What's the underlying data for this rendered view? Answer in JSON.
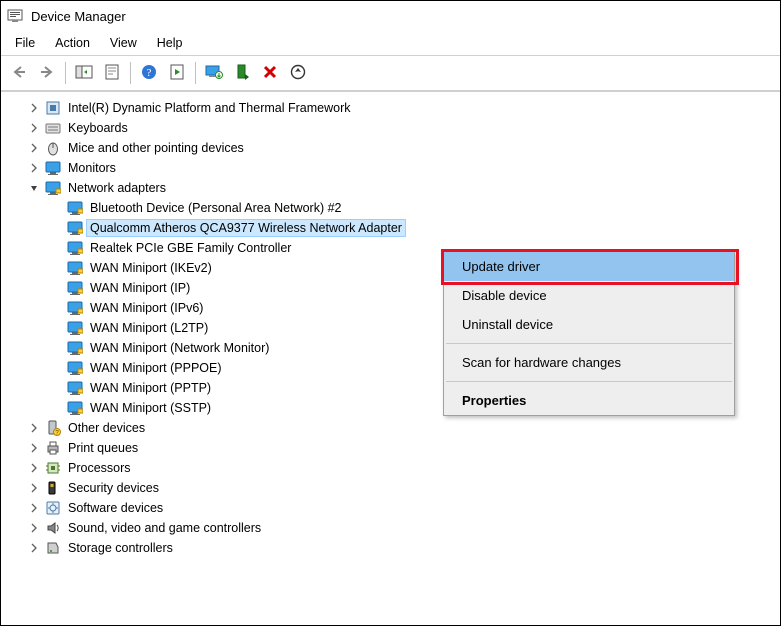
{
  "window": {
    "title": "Device Manager"
  },
  "menubar": {
    "items": [
      "File",
      "Action",
      "View",
      "Help"
    ]
  },
  "toolbar": {
    "back": "back",
    "forward": "forward",
    "showhide": "showhide",
    "properties": "properties",
    "help": "help",
    "refresh": "refresh",
    "updatecfg": "updatecfg",
    "enable": "enable",
    "uninstall": "uninstall",
    "scan": "scan"
  },
  "tree": [
    {
      "icon": "platform",
      "label": "Intel(R) Dynamic Platform and Thermal Framework",
      "expand": ">"
    },
    {
      "icon": "keyboard",
      "label": "Keyboards",
      "expand": ">"
    },
    {
      "icon": "mouse",
      "label": "Mice and other pointing devices",
      "expand": ">"
    },
    {
      "icon": "monitor",
      "label": "Monitors",
      "expand": ">"
    },
    {
      "icon": "network",
      "label": "Network adapters",
      "expand": "v",
      "children": [
        {
          "icon": "network",
          "label": "Bluetooth Device (Personal Area Network) #2"
        },
        {
          "icon": "network",
          "label": "Qualcomm Atheros QCA9377 Wireless Network Adapter",
          "selected": true
        },
        {
          "icon": "network",
          "label": "Realtek PCIe GBE Family Controller"
        },
        {
          "icon": "network",
          "label": "WAN Miniport (IKEv2)"
        },
        {
          "icon": "network",
          "label": "WAN Miniport (IP)"
        },
        {
          "icon": "network",
          "label": "WAN Miniport (IPv6)"
        },
        {
          "icon": "network",
          "label": "WAN Miniport (L2TP)"
        },
        {
          "icon": "network",
          "label": "WAN Miniport (Network Monitor)"
        },
        {
          "icon": "network",
          "label": "WAN Miniport (PPPOE)"
        },
        {
          "icon": "network",
          "label": "WAN Miniport (PPTP)"
        },
        {
          "icon": "network",
          "label": "WAN Miniport (SSTP)"
        }
      ]
    },
    {
      "icon": "other",
      "label": "Other devices",
      "expand": ">"
    },
    {
      "icon": "printer",
      "label": "Print queues",
      "expand": ">"
    },
    {
      "icon": "cpu",
      "label": "Processors",
      "expand": ">"
    },
    {
      "icon": "security",
      "label": "Security devices",
      "expand": ">"
    },
    {
      "icon": "software",
      "label": "Software devices",
      "expand": ">"
    },
    {
      "icon": "sound",
      "label": "Sound, video and game controllers",
      "expand": ">"
    },
    {
      "icon": "storage",
      "label": "Storage controllers",
      "expand": ">"
    }
  ],
  "context_menu": {
    "items": [
      {
        "label": "Update driver",
        "highlighted": true
      },
      {
        "label": "Disable device"
      },
      {
        "label": "Uninstall device"
      },
      {
        "sep": true
      },
      {
        "label": "Scan for hardware changes"
      },
      {
        "sep": true
      },
      {
        "label": "Properties",
        "bold": true
      }
    ]
  }
}
